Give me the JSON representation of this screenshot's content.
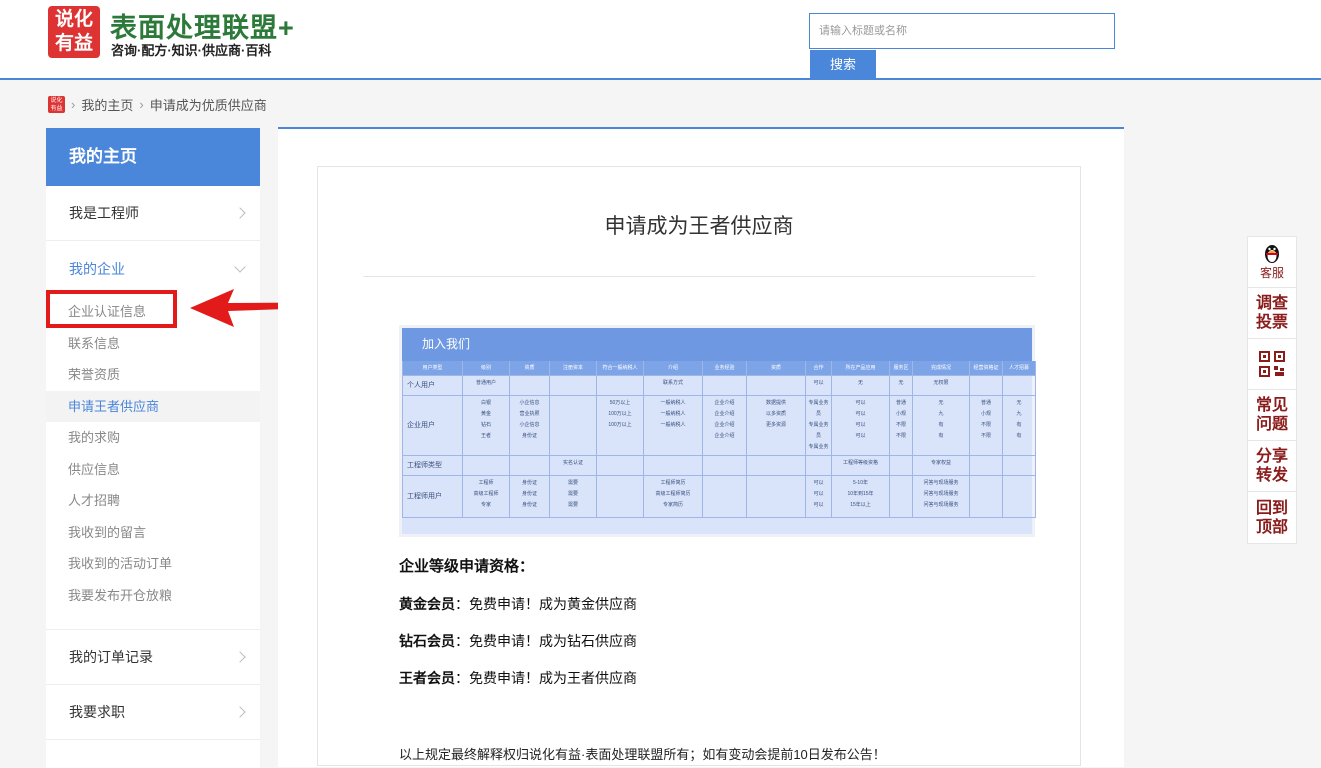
{
  "header": {
    "logo_text": "说化有益",
    "brand_title": "表面处理联盟+",
    "brand_subtitle": "咨询·配方·知识·供应商·百科",
    "search_placeholder": "请输入标题或名称",
    "search_button": "搜索"
  },
  "breadcrumb": {
    "home_icon_text": "说化有益",
    "items": [
      "我的主页",
      "申请成为优质供应商"
    ]
  },
  "sidebar": {
    "title": "我的主页",
    "engineer": "我是工程师",
    "enterprise": "我的企业",
    "sub_items": [
      "企业认证信息",
      "联系信息",
      "荣誉资质",
      "申请王者供应商",
      "我的求购",
      "供应信息",
      "人才招聘",
      "我收到的留言",
      "我收到的活动订单",
      "我要发布开仓放粮"
    ],
    "active_index": 3,
    "orders": "我的订单记录",
    "jobs": "我要求职"
  },
  "content": {
    "title": "申请成为王者供应商",
    "table_image": {
      "header": "加入我们",
      "columns": [
        "用户类型",
        "级别",
        "资质",
        "注册资本",
        "符合一般纳税人",
        "介绍",
        "业务经验",
        "资质",
        "合作",
        "所在产品应用",
        "服务区",
        "完成情况",
        "经营资格证",
        "人才招募"
      ],
      "rows": [
        [
          "个人用户",
          "普通用户",
          "",
          "",
          "",
          "联系方式",
          "",
          "",
          "可以",
          "无",
          "无",
          "无权限",
          "",
          ""
        ],
        [
          "企业用户",
          "白银\n黄金\n钻石\n王者",
          "小企信息\n营业执照\n小企信息\n身份证",
          "",
          "50万以上\n100万以上\n100万以上",
          "一般纳税人\n一般纳税人\n一般纳税人",
          "企业介绍\n企业介绍\n企业介绍\n企业介绍",
          "数据提供\n以多资质\n更多资源",
          "专属业务员\n专属业务员\n专属业务员",
          "可以\n可以\n可以\n可以",
          "普通\n小规\n不限\n不限",
          "无\n九\n有\n有",
          "普通\n小规\n不限\n不限",
          "无\n九\n有\n有"
        ],
        [
          "工程师类型",
          "",
          "",
          "实名认证",
          "",
          "",
          "",
          "",
          "",
          "工程师等级资格",
          "",
          "专家权益",
          "",
          ""
        ],
        [
          "工程师用户",
          "工程师\n高级工程师\n专家",
          "身份证\n身份证\n身份证",
          "需要\n需要\n需要",
          "",
          "工程师简历\n高级工程师简历\n专家简历",
          "",
          "",
          "可以\n可以\n可以",
          "5-10年\n10年到15年\n15年以上",
          "",
          "问答与现场服务\n问答与现场服务\n问答与现场服务",
          "",
          ""
        ]
      ]
    },
    "qualification_title": "企业等级申请资格：",
    "levels": [
      {
        "name": "黄金会员",
        "text": "：免费申请！成为黄金供应商"
      },
      {
        "name": "钻石会员",
        "text": "：免费申请！成为钻石供应商"
      },
      {
        "name": "王者会员",
        "text": "：免费申请！成为王者供应商"
      }
    ],
    "footnote": "以上规定最终解释权归说化有益·表面处理联盟所有；如有变动会提前10日发布公告！"
  },
  "float_bar": {
    "items": [
      "客服",
      "调查投票",
      "",
      "常见问题",
      "分享转发",
      "回到顶部"
    ]
  },
  "colors": {
    "accent": "#4a86d9",
    "brand_green": "#2c7a3a",
    "logo_red": "#d33333",
    "highlight_red": "#e21a1a",
    "float_text": "#8a1c1c"
  }
}
